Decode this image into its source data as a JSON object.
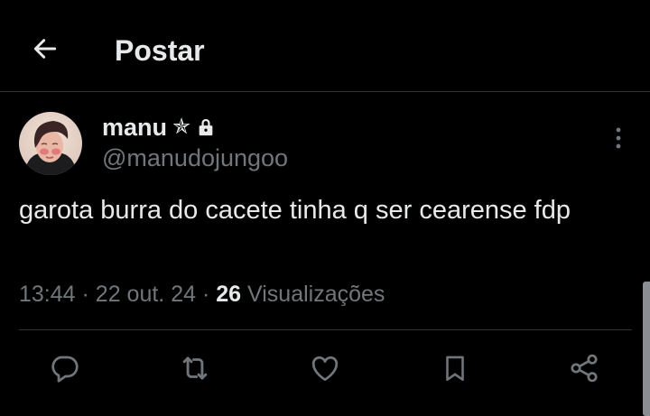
{
  "header": {
    "back_icon": "arrow-left-icon",
    "title": "Postar"
  },
  "post": {
    "author": {
      "display_name": "manu",
      "name_symbol": "✯",
      "handle": "@manudojungoo",
      "protected_icon": "lock-icon"
    },
    "text": "garota burra do cacete tinha q ser cearense fdp",
    "time": "13:44",
    "date": "22 out. 24",
    "separator": "·",
    "views_count": "26",
    "views_label": "Visualizações",
    "more_icon": "more-vertical-icon"
  },
  "actions": [
    {
      "icon": "reply-icon"
    },
    {
      "icon": "repost-icon"
    },
    {
      "icon": "like-icon"
    },
    {
      "icon": "bookmark-icon"
    },
    {
      "icon": "share-icon"
    }
  ],
  "colors": {
    "background": "#000000",
    "text_primary": "#e7e9ea",
    "text_secondary": "#71767b",
    "divider": "#2f3336"
  }
}
